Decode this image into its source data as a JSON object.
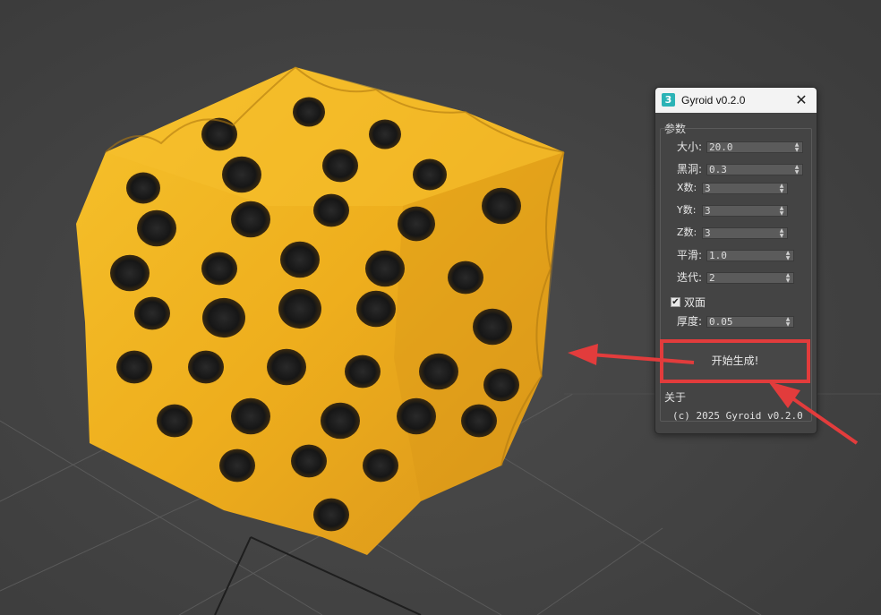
{
  "dialog": {
    "title": "Gyroid v0.2.0",
    "app_icon_glyph": "3",
    "close_glyph": "✕",
    "params_group_label": "参数",
    "params": [
      {
        "label": "大小:",
        "value": "20.0"
      },
      {
        "label": "黑洞:",
        "value": "0.3"
      },
      {
        "label": "X数:",
        "value": "3"
      },
      {
        "label": "Y数:",
        "value": "3"
      },
      {
        "label": "Z数:",
        "value": "3"
      },
      {
        "label": "平滑:",
        "value": "1.0"
      },
      {
        "label": "迭代:",
        "value": "2"
      }
    ],
    "double_sided": {
      "label": "双面",
      "checked": true,
      "check_glyph": "✔"
    },
    "thickness": {
      "label": "厚度:",
      "value": "0.05"
    },
    "start_button_label": "开始生成!",
    "about_group_label": "关于",
    "about_text": "(c) 2025 Gyroid v0.2.0"
  },
  "icons": {
    "app": "3dsmax-app-icon",
    "close": "close-icon",
    "spinner": "spinner-arrows-icon",
    "check": "checkmark-icon"
  },
  "colors": {
    "viewport_background": "#454545",
    "grid_line": "#555555",
    "model_gold": "#f0b321",
    "annotation_red": "#e23c3c",
    "dialog_background": "#444444",
    "titlebar_background": "#f3f3f3"
  }
}
